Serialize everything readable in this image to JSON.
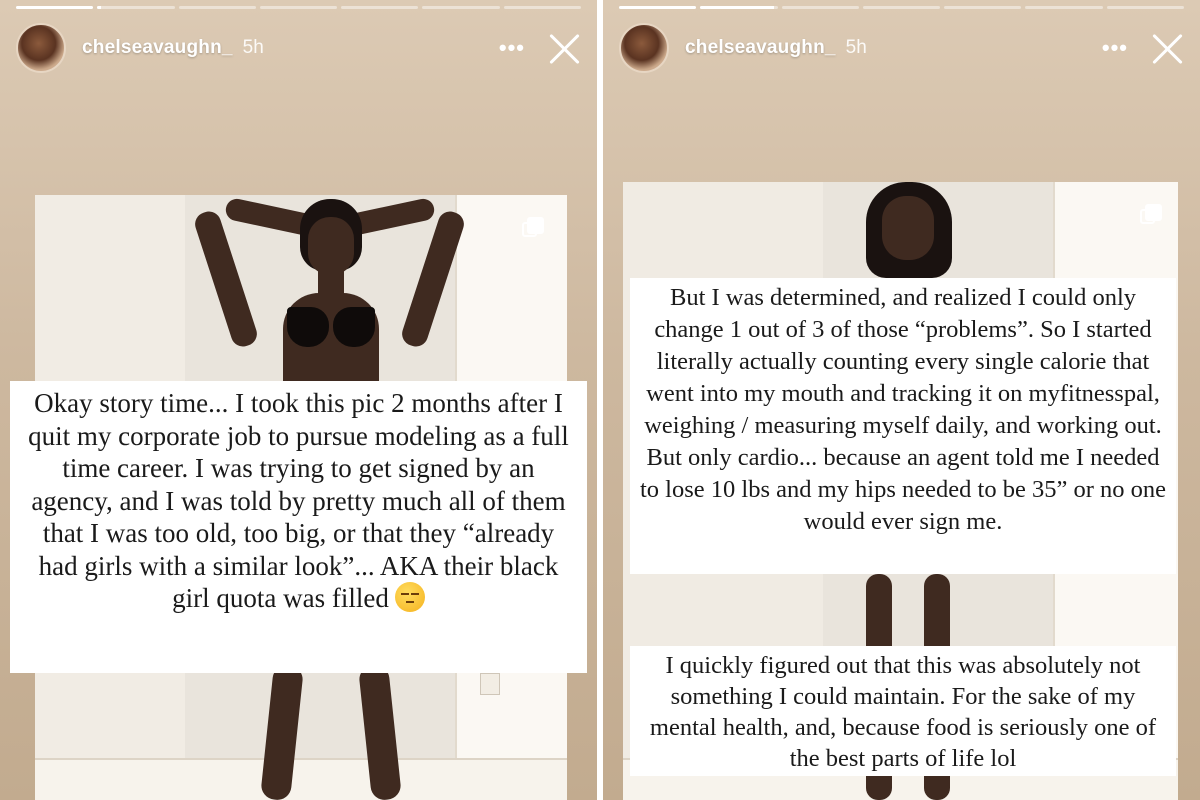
{
  "stories": [
    {
      "username": "chelseavaughn_",
      "time_ago": "5h",
      "more_label": "•••",
      "progress": [
        1,
        0.05,
        0,
        0,
        0,
        0,
        0
      ],
      "caption": "Okay story time... I took this pic 2 months after I quit my corporate job to pursue modeling as a full time career. I was trying to get signed by an agency, and I was told by pretty much all of them that I was too old, too big, or that they “already had girls with a similar look”... AKA their black girl quota was filled",
      "emoji": "unamused-face"
    },
    {
      "username": "chelseavaughn_",
      "time_ago": "5h",
      "more_label": "•••",
      "progress": [
        1,
        0.95,
        0,
        0,
        0,
        0,
        0
      ],
      "caption_top": "But I was determined, and realized I could only change 1 out of 3 of those “problems”. So I started literally actually counting every single calorie that went into my mouth and tracking it on myfitnesspal, weighing / measuring myself daily, and working out. But only cardio... because an agent told me I needed to lose 10 lbs and my hips needed to be 35” or no one would ever sign me.",
      "caption_bottom": "I quickly figured out that this was absolutely not something I could maintain. For the sake of my mental health, and, because food is seriously one of the best parts of life lol"
    }
  ],
  "colors": {
    "story_bg": "#cdb89f",
    "caption_bg": "#ffffff",
    "text": "#1a1a1a",
    "skin": "#3f2a20"
  },
  "icons": {
    "close": "close-icon",
    "more": "more-options-icon",
    "carousel": "multiple-photos-icon"
  }
}
